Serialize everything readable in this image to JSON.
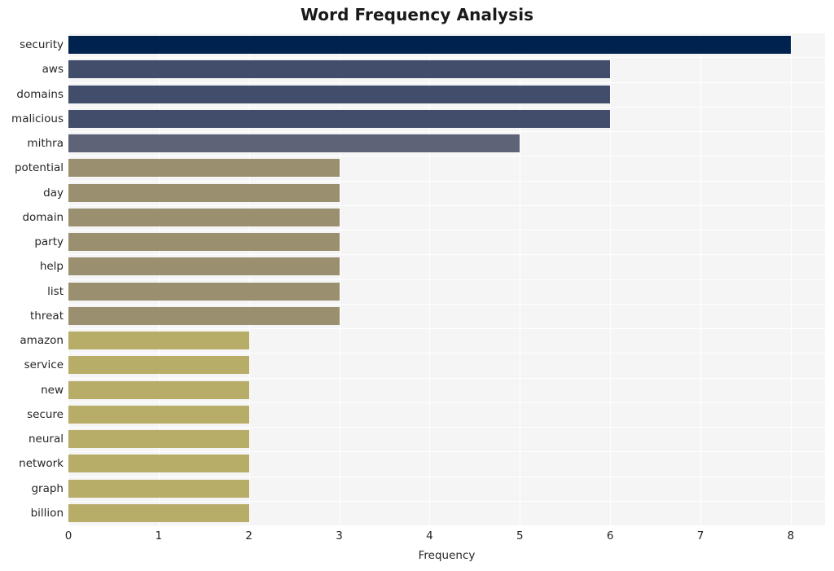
{
  "chart_data": {
    "type": "bar",
    "orientation": "horizontal",
    "title": "Word Frequency Analysis",
    "xlabel": "Frequency",
    "ylabel": "",
    "xlim": [
      0,
      8.38
    ],
    "xticks": [
      0,
      1,
      2,
      3,
      4,
      5,
      6,
      7,
      8
    ],
    "xtick_labels": [
      "0",
      "1",
      "2",
      "3",
      "4",
      "5",
      "6",
      "7",
      "8"
    ],
    "grid": true,
    "legend": false,
    "categories": [
      "security",
      "aws",
      "domains",
      "malicious",
      "mithra",
      "potential",
      "day",
      "domain",
      "party",
      "help",
      "list",
      "threat",
      "amazon",
      "service",
      "new",
      "secure",
      "neural",
      "network",
      "graph",
      "billion"
    ],
    "values": [
      8,
      6,
      6,
      6,
      5,
      3,
      3,
      3,
      3,
      3,
      3,
      3,
      2,
      2,
      2,
      2,
      2,
      2,
      2,
      2
    ],
    "bar_colors": [
      "#00224e",
      "#414d6b",
      "#414d6b",
      "#414d6b",
      "#5f6377",
      "#9a9070",
      "#9a9070",
      "#9a9070",
      "#9a9070",
      "#9a9070",
      "#9a9070",
      "#9a9070",
      "#b8ad68",
      "#b8ad68",
      "#b8ad68",
      "#b8ad68",
      "#b8ad68",
      "#b8ad68",
      "#b8ad68",
      "#b8ad68"
    ],
    "plot_background": "#f5f5f6",
    "gridline_color": "#ffffff",
    "text_color": "#262626"
  }
}
